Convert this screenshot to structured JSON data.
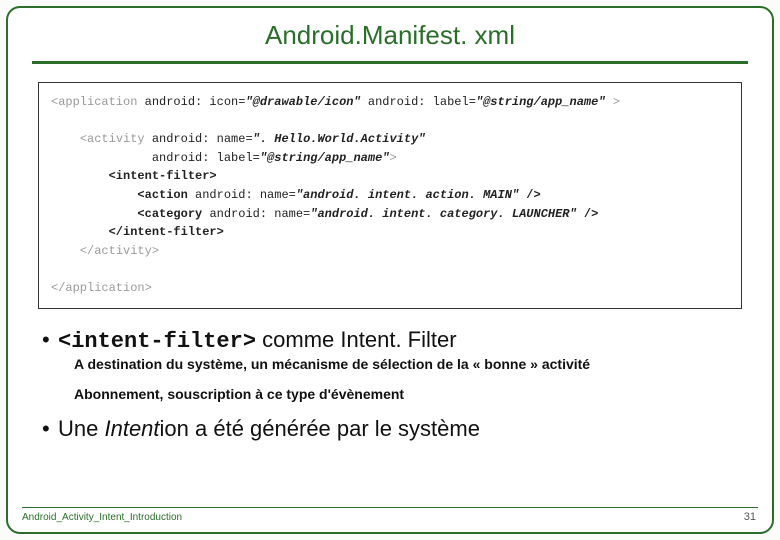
{
  "title": "Android.Manifest. xml",
  "code": {
    "l1_open": "<application ",
    "l1_attr": "android: icon=",
    "l1_val": "\"@drawable/icon\"",
    "l1_attr2": " android: label=",
    "l1_val2": "\"@string/app_name\"",
    "l1_close": " >",
    "l2_open": "<activity ",
    "l2_attr": "android: name=",
    "l2_val": "\". Hello.World.Activity\"",
    "l3_attr": "android: label=",
    "l3_val": "\"@string/app_name\"",
    "l3_close": ">",
    "l4": "<intent-filter>",
    "l5_open": "<action ",
    "l5_attr": "android: name=",
    "l5_val": "\"android. intent. action. MAIN\"",
    "l5_close": " />",
    "l6_open": "<category ",
    "l6_attr": "android: name=",
    "l6_val": "\"android. intent. category. LAUNCHER\"",
    "l6_close": " />",
    "l7": "</intent-filter>",
    "l8": "</activity>",
    "l9": "</application>"
  },
  "bullet1_mono": "<intent-filter>",
  "bullet1_rest": "   comme Intent. Filter",
  "bullet1_sub1": "A destination du système, un mécanisme de sélection de la « bonne » activité",
  "bullet1_sub2": "Abonnement, souscription à ce type d'évènement",
  "bullet2_pre": "Une ",
  "bullet2_it": "Intent",
  "bullet2_post": "ion a été générée par le système",
  "footer": "Android_Activity_Intent_Introduction",
  "page": "31"
}
